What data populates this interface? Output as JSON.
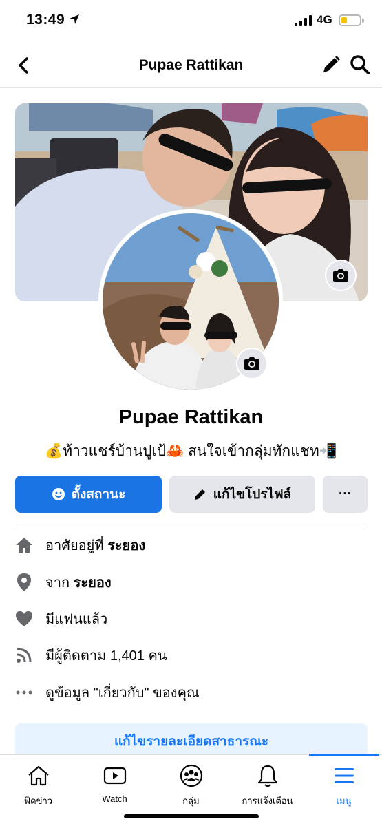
{
  "status_bar": {
    "time": "13:49",
    "network": "4G"
  },
  "header": {
    "title": "Pupae Rattikan"
  },
  "profile": {
    "name": "Pupae Rattikan",
    "bio": "💰ท้าวแชร์บ้านปูเป้🦀 สนใจเข้ากลุ่มทักแชท📲"
  },
  "actions": {
    "status_label": "ตั้งสถานะ",
    "edit_label": "แก้ไขโปรไฟล์",
    "more_label": "···"
  },
  "info": {
    "lives_prefix": "อาศัยอยู่ที่ ",
    "lives_value": "ระยอง",
    "from_prefix": "จาก ",
    "from_value": "ระยอง",
    "relationship": "มีแฟนแล้ว",
    "followers": "มีผู้ติดตาม 1,401 คน",
    "about": "ดูข้อมูล \"เกี่ยวกับ\" ของคุณ"
  },
  "edit_public_label": "แก้ไขรายละเอียดสาธารณะ",
  "tabs": [
    {
      "label": "ฟีดข่าว",
      "icon": "home-icon"
    },
    {
      "label": "Watch",
      "icon": "watch-icon"
    },
    {
      "label": "กลุ่ม",
      "icon": "groups-icon"
    },
    {
      "label": "การแจ้งเตือน",
      "icon": "bell-icon"
    },
    {
      "label": "เมนู",
      "icon": "menu-icon",
      "active": true
    }
  ],
  "colors": {
    "primary": "#1b74e4",
    "link": "#1877f2",
    "secondary_button": "#e4e6eb",
    "light_blue": "#e7f3ff"
  }
}
